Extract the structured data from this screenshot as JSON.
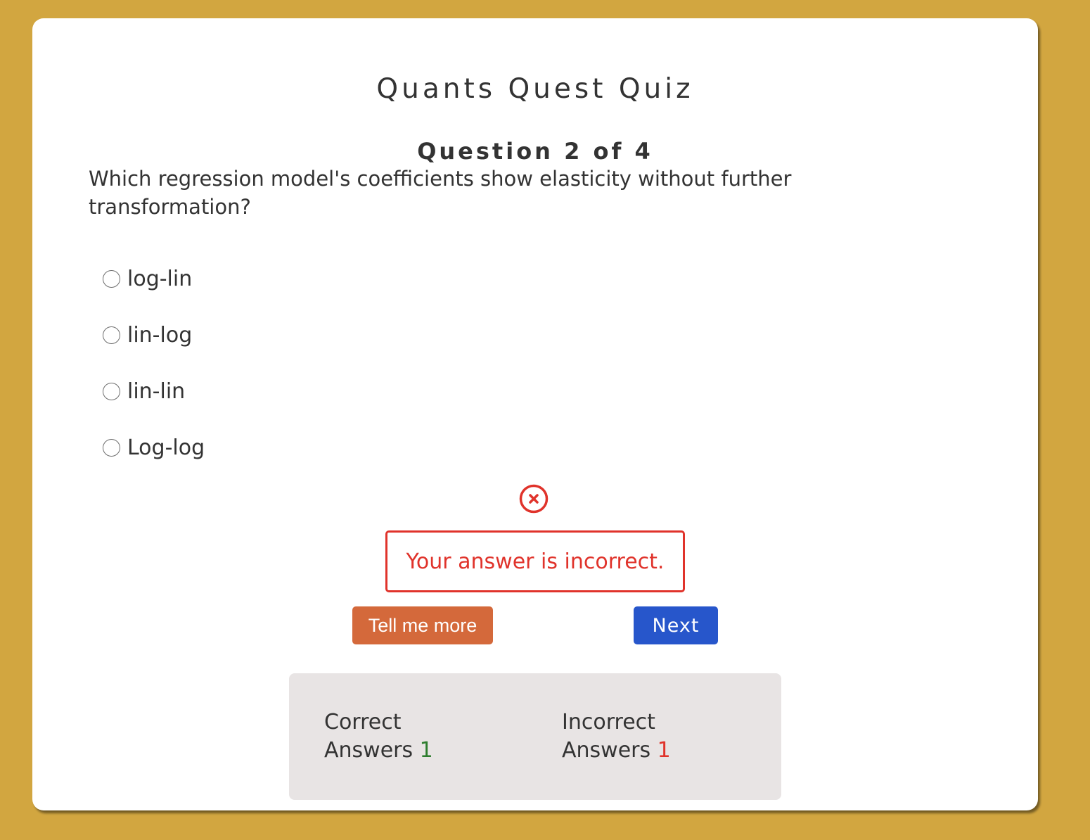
{
  "quiz": {
    "title": "Quants Quest Quiz",
    "counter": "Question 2 of 4",
    "question": "Which regression model's coefficients show elasticity without further transformation?",
    "options": [
      {
        "label": "log-lin",
        "selected": false
      },
      {
        "label": "lin-log",
        "selected": false
      },
      {
        "label": "lin-lin",
        "selected": false
      },
      {
        "label": "Log-log",
        "selected": false
      }
    ]
  },
  "feedback": {
    "icon": "x-circle-icon",
    "message": "Your answer is incorrect.",
    "color": "#e0332b"
  },
  "actions": {
    "more_label": "Tell me more",
    "next_label": "Next"
  },
  "score": {
    "correct_label_line1": "Correct",
    "correct_label_line2": "Answers",
    "correct_count": "1",
    "incorrect_label_line1": "Incorrect",
    "incorrect_label_line2": "Answers",
    "incorrect_count": "1"
  },
  "colors": {
    "background": "#d2a640",
    "more_button": "#d4693b",
    "next_button": "#2756cb",
    "correct": "#2e7d2e",
    "incorrect": "#e0332b"
  }
}
